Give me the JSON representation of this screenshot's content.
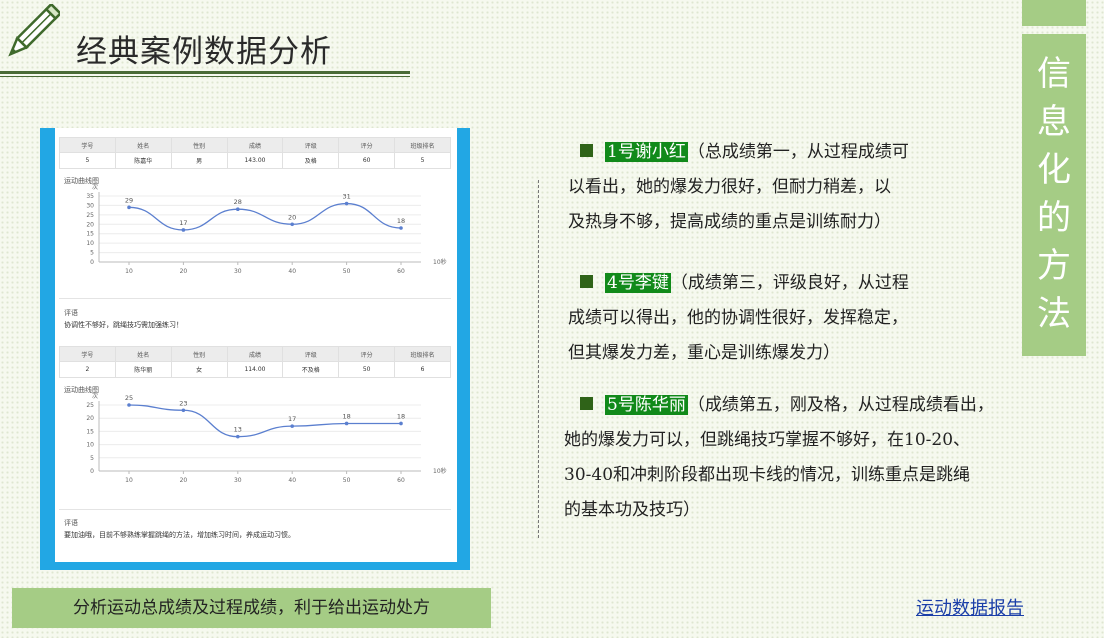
{
  "header": {
    "title": "经典案例数据分析"
  },
  "side_tab": {
    "chars": [
      "信",
      "息",
      "化",
      "的",
      "方",
      "法"
    ]
  },
  "report": {
    "columns": [
      "学号",
      "姓名",
      "性别",
      "成绩",
      "评级",
      "评分",
      "班级排名"
    ],
    "students": [
      {
        "row": [
          "5",
          "陈嘉华",
          "男",
          "143.00",
          "及格",
          "60",
          "5"
        ],
        "chart_title": "运动曲线图",
        "y_unit": "次",
        "x_unit": "10秒",
        "y_ticks": [
          "0",
          "5",
          "10",
          "15",
          "20",
          "25",
          "30",
          "35"
        ],
        "comment_label": "评语",
        "comment": "协调性不够好，跳绳技巧需加强练习！"
      },
      {
        "row": [
          "2",
          "陈华丽",
          "女",
          "114.00",
          "不及格",
          "50",
          "6"
        ],
        "chart_title": "运动曲线图",
        "y_unit": "次",
        "x_unit": "10秒",
        "y_ticks": [
          "0",
          "5",
          "10",
          "15",
          "20",
          "25"
        ],
        "comment_label": "评语",
        "comment": "要加油哦，目前不够熟练掌握跳绳的方法，增加练习时间，养成运动习惯。"
      }
    ]
  },
  "chart_data": [
    {
      "type": "line",
      "title": "运动曲线图",
      "xlabel": "10秒",
      "ylabel": "次",
      "x": [
        10,
        20,
        30,
        40,
        50,
        60
      ],
      "series": [
        {
          "values": [
            29,
            17,
            28,
            20,
            31,
            18
          ]
        }
      ],
      "ylim": [
        0,
        35
      ]
    },
    {
      "type": "line",
      "title": "运动曲线图",
      "xlabel": "10秒",
      "ylabel": "次",
      "x": [
        10,
        20,
        30,
        40,
        50,
        60
      ],
      "series": [
        {
          "values": [
            25,
            23,
            13,
            17,
            18,
            18
          ]
        }
      ],
      "ylim": [
        0,
        25
      ]
    }
  ],
  "analysis": [
    {
      "name": "1号谢小红",
      "text_lines": [
        "（总成绩第一，从过程成绩可",
        "以看出，她的爆发力很好，但耐力稍差，以",
        "及热身不够，提高成绩的重点是训练耐力）"
      ]
    },
    {
      "name": "4号李键",
      "text_lines": [
        "（成绩第三，评级良好，从过程",
        "成绩可以得出，他的协调性很好，发挥稳定，",
        "但其爆发力差，重心是训练爆发力）"
      ]
    },
    {
      "name": "5号陈华丽",
      "text_lines": [
        "（成绩第五，刚及格，从过程成绩看出，",
        "她的爆发力可以，但跳绳技巧掌握不够好，在10-20、",
        "30-40和冲刺阶段都出现卡线的情况，训练重点是跳绳",
        "的基本功及技巧）"
      ]
    }
  ],
  "footer": {
    "summary": "分析运动总成绩及过程成绩，利于给出运动处方",
    "link": "运动数据报告"
  },
  "colors": {
    "accent_green": "#a5cc85",
    "dark_green": "#4a6b36",
    "highlight": "#118a1a",
    "frame_blue": "#22a7e4",
    "line_blue": "#5b7fcf"
  }
}
